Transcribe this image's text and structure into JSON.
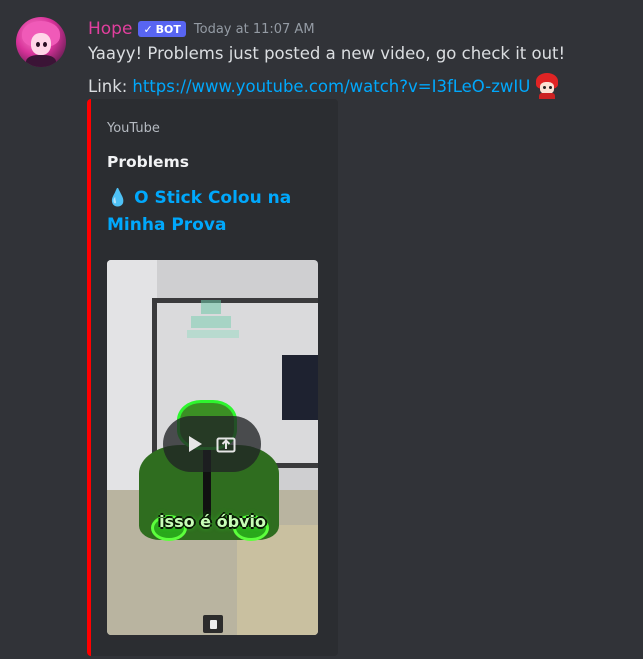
{
  "message": {
    "username": "Hope",
    "bot_badge": "BOT",
    "timestamp": "Today at 11:07 AM",
    "text_line1": "Yaayy! Problems just posted a new video, go check it out!",
    "link_prefix": "Link:",
    "link_url": "https://www.youtube.com/watch?v=I3fLeO-zwIU"
  },
  "embed": {
    "provider": "YouTube",
    "author": "Problems",
    "title": "💧 O Stick Colou na Minha Prova",
    "accent_color": "#ff0000",
    "video_caption": "isso é óbvio"
  },
  "colors": {
    "background": "#313338",
    "username": "#e23f9e",
    "bot_badge": "#5865f2",
    "link": "#00a8fc"
  },
  "icons": {
    "avatar": "avatar",
    "verified_check": "check-icon",
    "play": "play-icon",
    "popout": "popout-icon"
  }
}
